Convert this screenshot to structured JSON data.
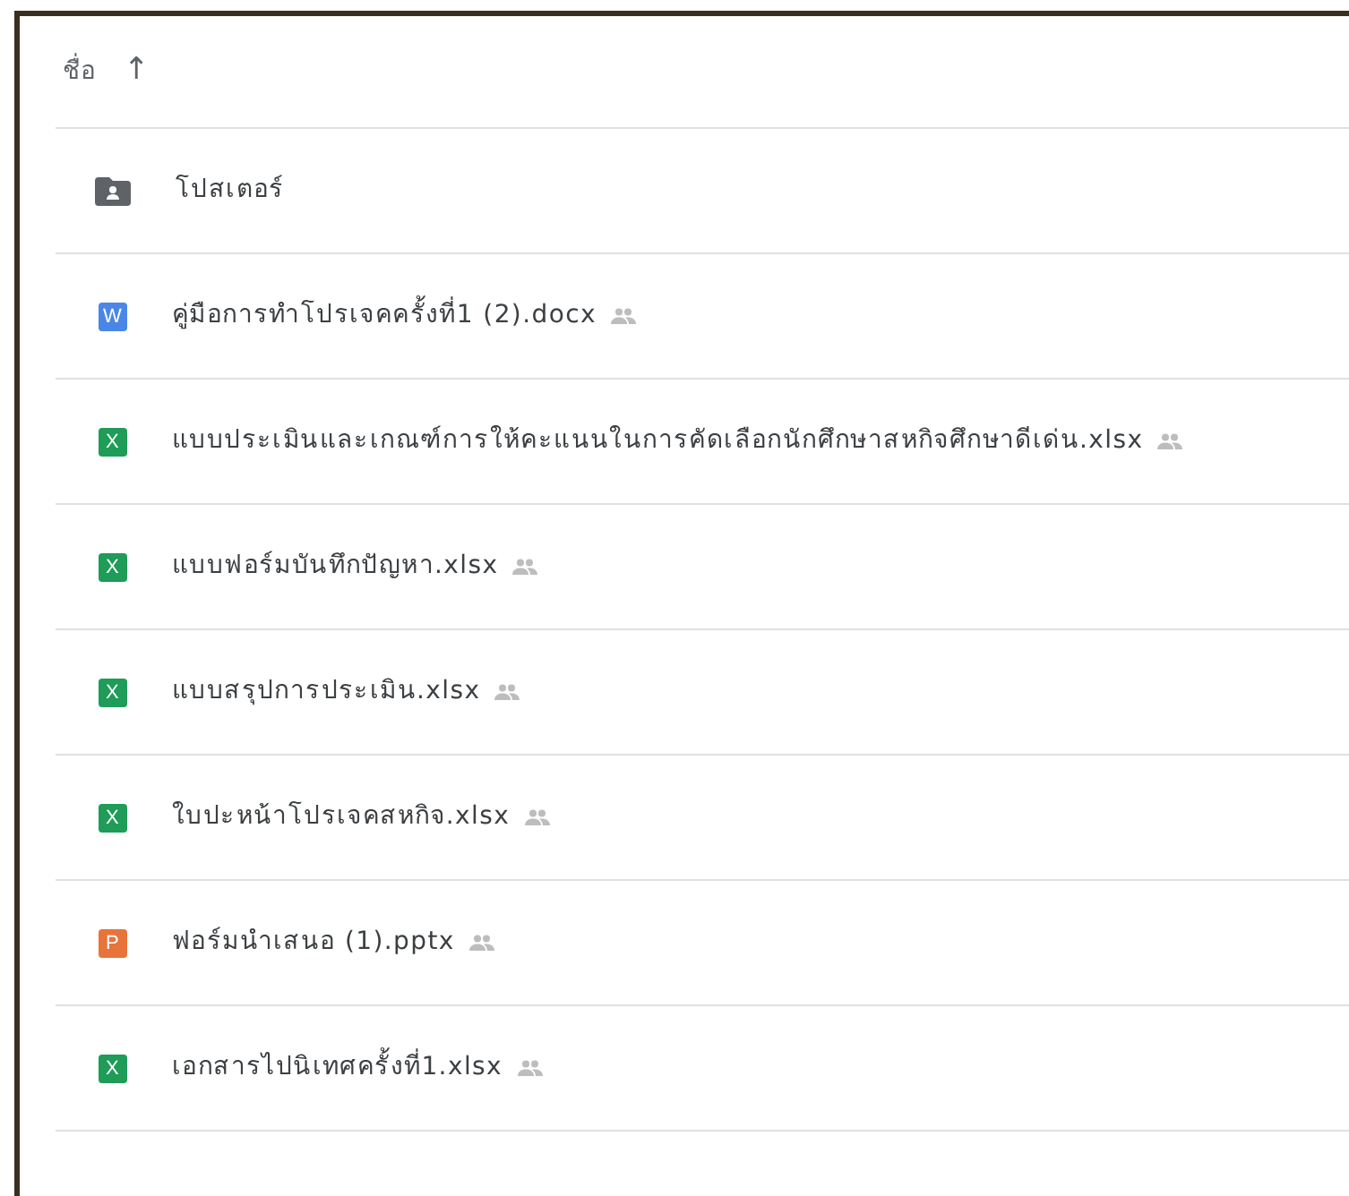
{
  "header": {
    "label": "ชื่อ",
    "sort_arrow": "↑"
  },
  "files": [
    {
      "kind": "folder",
      "name": "โปสเตอร์",
      "shared": false
    },
    {
      "kind": "docx",
      "icon_letter": "W",
      "name": "คู่มือการทำโปรเจคครั้งที่1 (2).docx",
      "shared": true
    },
    {
      "kind": "xlsx",
      "icon_letter": "X",
      "name": "แบบประเมินและเกณฑ์การให้คะแนนในการคัดเลือกนักศึกษาสหกิจศึกษาดีเด่น.xlsx",
      "shared": true
    },
    {
      "kind": "xlsx",
      "icon_letter": "X",
      "name": "แบบฟอร์มบันทึกปัญหา.xlsx",
      "shared": true
    },
    {
      "kind": "xlsx",
      "icon_letter": "X",
      "name": "แบบสรุปการประเมิน.xlsx",
      "shared": true
    },
    {
      "kind": "xlsx",
      "icon_letter": "X",
      "name": "ใบปะหน้าโปรเจคสหกิจ.xlsx",
      "shared": true
    },
    {
      "kind": "pptx",
      "icon_letter": "P",
      "name": "ฟอร์มนำเสนอ (1).pptx",
      "shared": true
    },
    {
      "kind": "xlsx",
      "icon_letter": "X",
      "name": "เอกสารไปนิเทศครั้งที่1.xlsx",
      "shared": true
    }
  ]
}
